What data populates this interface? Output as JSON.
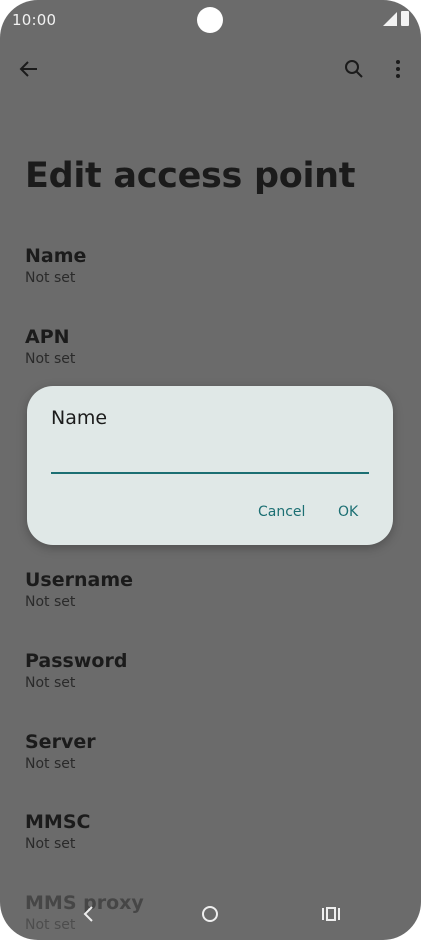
{
  "status": {
    "time": "10:00"
  },
  "toolbar": {
    "back_icon": "arrow-back-icon",
    "search_icon": "search-icon",
    "more_icon": "more-vert-icon"
  },
  "page": {
    "title": "Edit access point"
  },
  "prefs": [
    {
      "title": "Name",
      "summary": "Not set"
    },
    {
      "title": "APN",
      "summary": "Not set"
    },
    {
      "title": "Username",
      "summary": "Not set"
    },
    {
      "title": "Password",
      "summary": "Not set"
    },
    {
      "title": "Server",
      "summary": "Not set"
    },
    {
      "title": "MMSC",
      "summary": "Not set"
    },
    {
      "title": "MMS proxy",
      "summary": "Not set"
    }
  ],
  "dialog": {
    "title": "Name",
    "value": "",
    "cancel": "Cancel",
    "ok": "OK"
  },
  "colors": {
    "scrim_bg": "#6b6b6b",
    "dialog_bg": "#e0e8e7",
    "accent": "#1c6f73"
  }
}
